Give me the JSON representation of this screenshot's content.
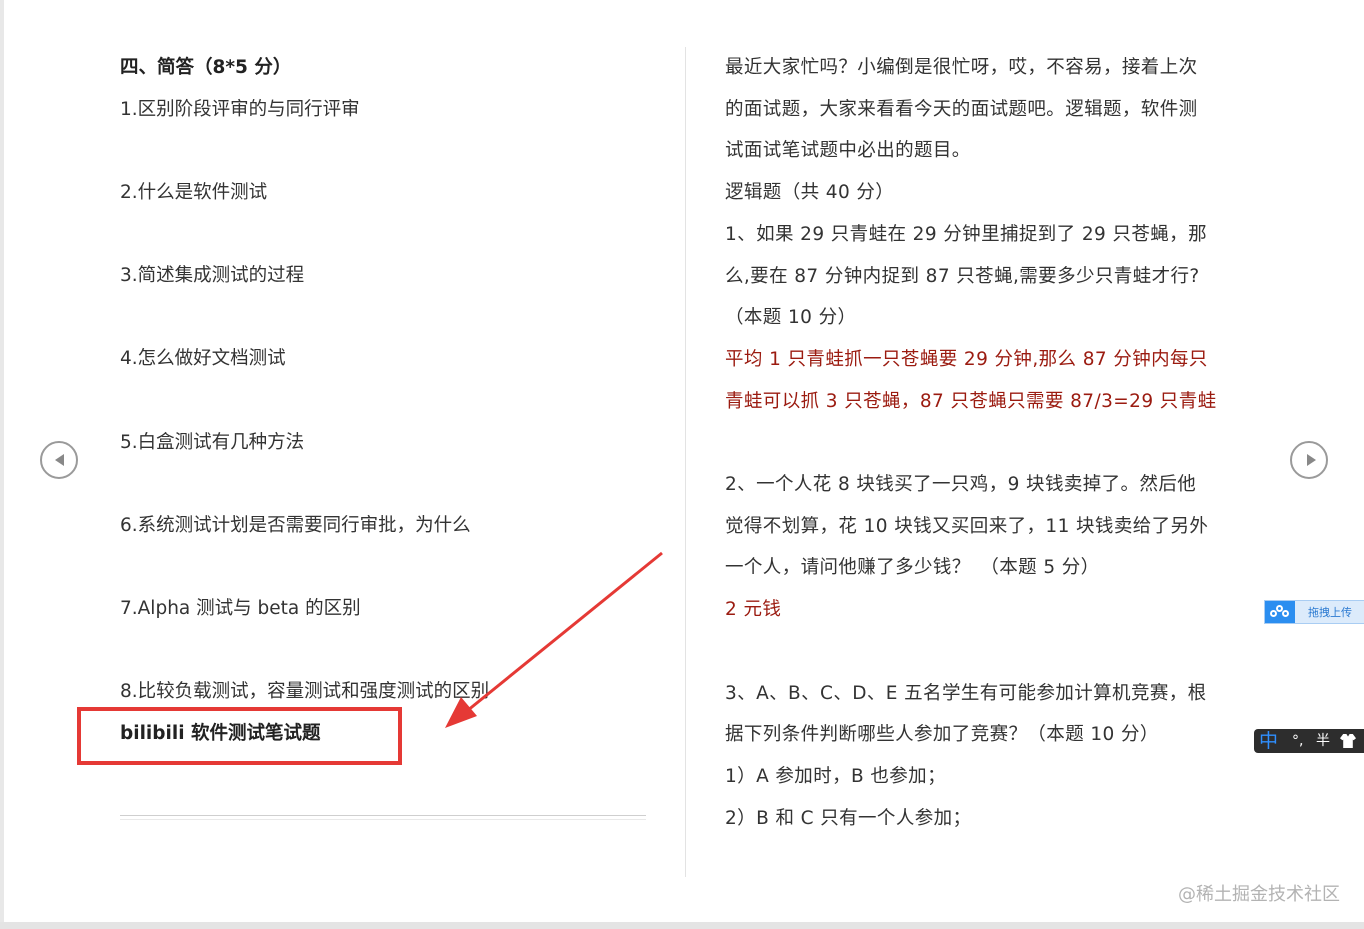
{
  "left": {
    "heading": "四、简答（8*5 分）",
    "questions": [
      "1.区别阶段评审的与同行评审",
      "2.什么是软件测试",
      "3.简述集成测试的过程",
      "4.怎么做好文档测试",
      "5.白盒测试有几种方法",
      "6.系统测试计划是否需要同行审批，为什么",
      "7.Alpha 测试与 beta 的区别",
      "8.比较负载测试，容量测试和强度测试的区别"
    ],
    "bold_title": "bilibili 软件测试笔试题"
  },
  "right": {
    "lines": [
      "最近大家忙吗？小编倒是很忙呀，哎，不容易，接着上次",
      "的面试题，大家来看看今天的面试题吧。逻辑题，软件测",
      "试面试笔试题中必出的题目。",
      "逻辑题（共 40 分）",
      "1、如果 29 只青蛙在 29 分钟里捕捉到了 29 只苍蝇，那",
      "么,要在 87 分钟内捉到 87 只苍蝇,需要多少只青蛙才行?",
      "（本题 10 分）"
    ],
    "answer1": [
      "平均 1 只青蛙抓一只苍蝇要 29 分钟,那么 87 分钟内每只",
      "青蛙可以抓 3 只苍蝇，87 只苍蝇只需要 87/3=29 只青蛙"
    ],
    "q2": [
      "2、一个人花 8 块钱买了一只鸡，9 块钱卖掉了。然后他",
      "觉得不划算，花 10 块钱又买回来了，11 块钱卖给了另外",
      "一个人，请问他赚了多少钱？　（本题 5 分）"
    ],
    "answer2": "2 元钱",
    "q3": [
      "3、A、B、C、D、E 五名学生有可能参加计算机竞赛，根",
      "据下列条件判断哪些人参加了竞赛？（本题 10 分）",
      "1）A 参加时，B 也参加；",
      "2）B 和 C 只有一个人参加；"
    ]
  },
  "widgets": {
    "upload_label": "拖拽上传",
    "ime_zh": "中",
    "ime_punct": "°,",
    "ime_half": "半"
  },
  "watermark": "@稀土掘金技术社区",
  "icons": {
    "prev": "chevron-left-icon",
    "next": "chevron-right-icon",
    "upload": "cloud-upload-icon",
    "ime_skin": "tshirt-icon"
  },
  "colors": {
    "text": "#333333",
    "answer": "#9b1b10",
    "highlight": "#e53935",
    "ime_bg": "#2d2d2d",
    "upload_blue": "#2b8ef0"
  }
}
